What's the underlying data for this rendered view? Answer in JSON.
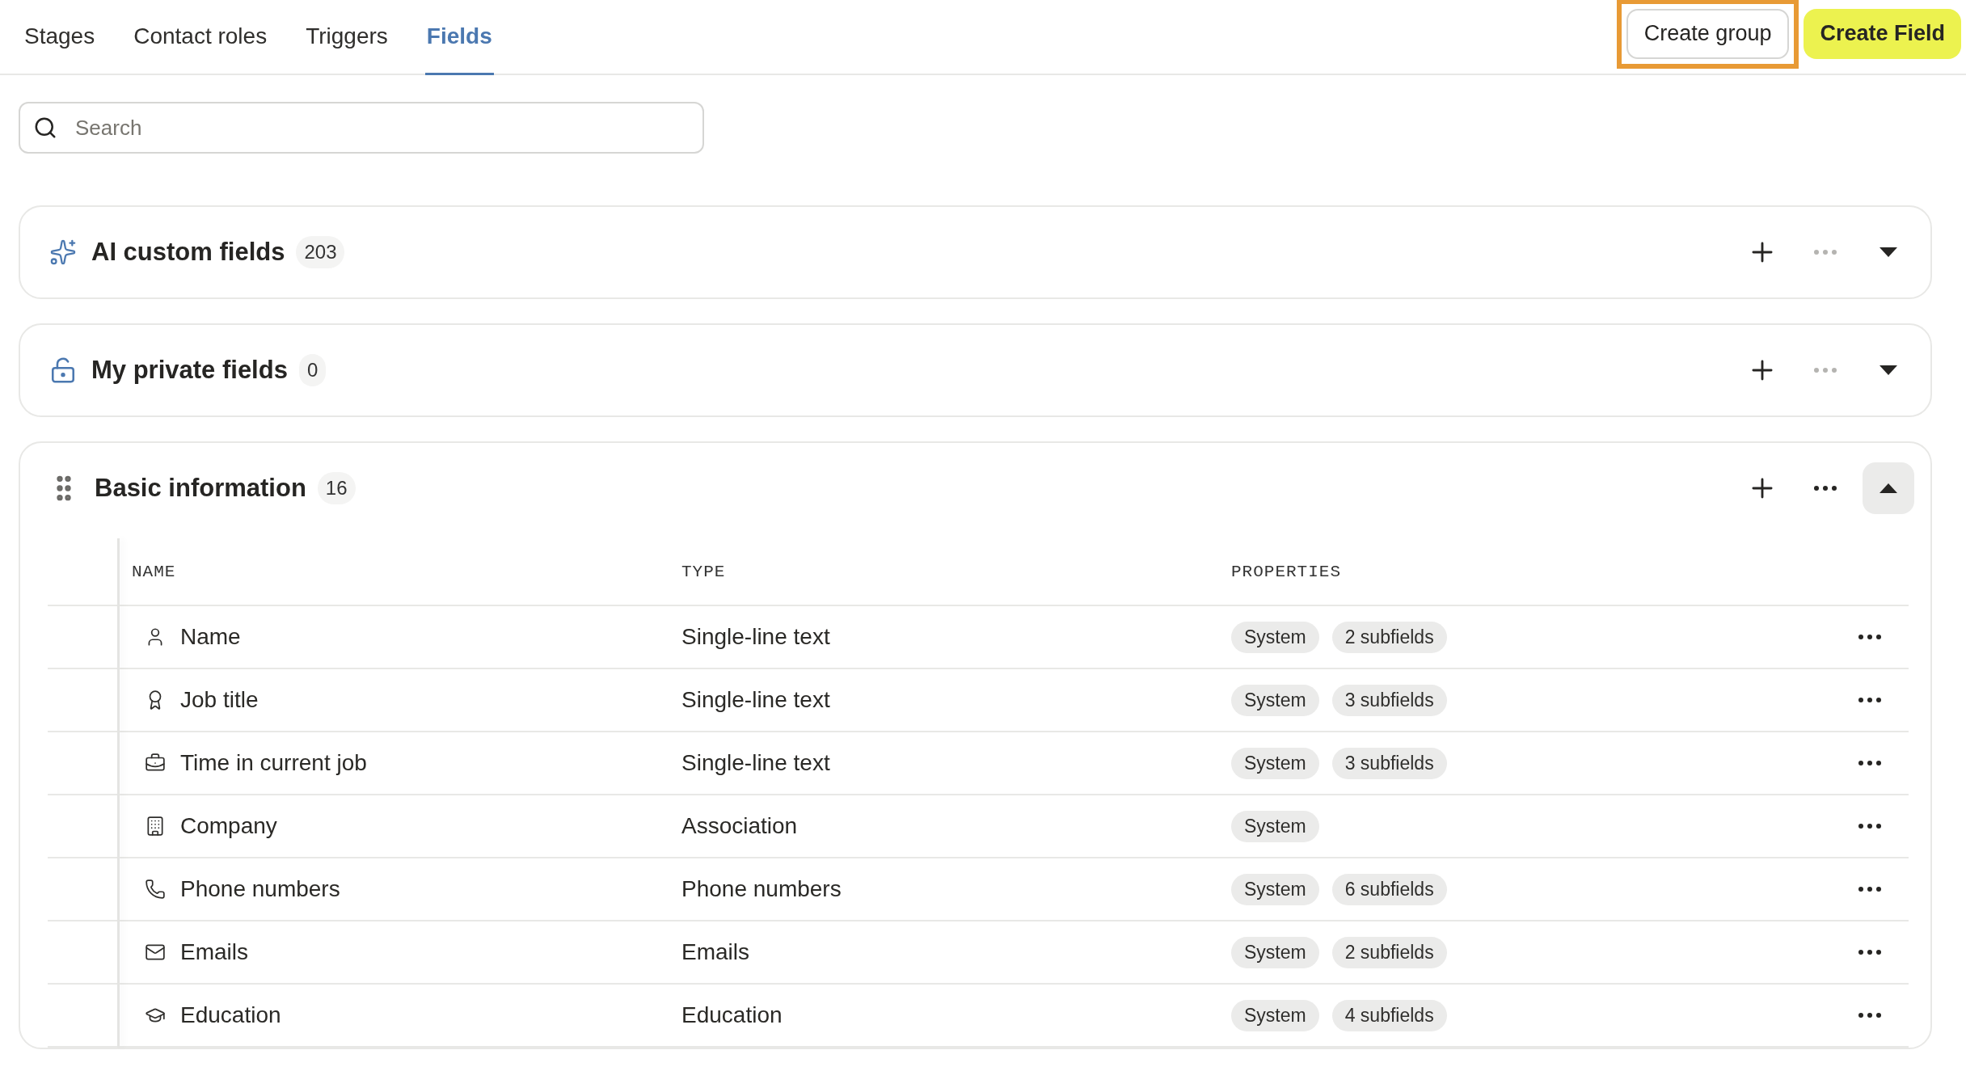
{
  "tabs": [
    {
      "label": "Stages",
      "selected": false
    },
    {
      "label": "Contact roles",
      "selected": false
    },
    {
      "label": "Triggers",
      "selected": false
    },
    {
      "label": "Fields",
      "selected": true
    }
  ],
  "actions": {
    "create_group": "Create group",
    "create_field": "Create Field"
  },
  "search": {
    "placeholder": "Search"
  },
  "groups": [
    {
      "kind": "ai",
      "title": "AI custom fields",
      "count": "203",
      "expanded": false
    },
    {
      "kind": "private",
      "title": "My private fields",
      "count": "0",
      "expanded": false
    },
    {
      "kind": "custom",
      "title": "Basic information",
      "count": "16",
      "expanded": true,
      "table": {
        "columns": [
          "NAME",
          "TYPE",
          "PROPERTIES"
        ],
        "rows": [
          {
            "name": "Name",
            "type": "Single-line text",
            "properties": [
              "System",
              "2 subfields"
            ]
          },
          {
            "name": "Job title",
            "type": "Single-line text",
            "properties": [
              "System",
              "3 subfields"
            ]
          },
          {
            "name": "Time in current job",
            "type": "Single-line text",
            "properties": [
              "System",
              "3 subfields"
            ]
          },
          {
            "name": "Company",
            "type": "Association",
            "properties": [
              "System"
            ]
          },
          {
            "name": "Phone numbers",
            "type": "Phone numbers",
            "properties": [
              "System",
              "6 subfields"
            ]
          },
          {
            "name": "Emails",
            "type": "Emails",
            "properties": [
              "System",
              "2 subfields"
            ]
          },
          {
            "name": "Education",
            "type": "Education",
            "properties": [
              "System",
              "4 subfields"
            ]
          }
        ]
      }
    }
  ]
}
